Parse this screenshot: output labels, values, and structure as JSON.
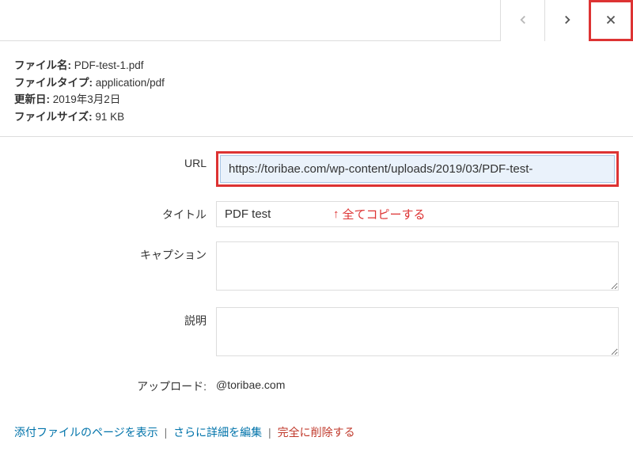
{
  "nav": {
    "prev_aria": "前へ",
    "next_aria": "次へ",
    "close_aria": "閉じる"
  },
  "meta": {
    "filename_label": "ファイル名:",
    "filename_value": "PDF-test-1.pdf",
    "filetype_label": "ファイルタイプ:",
    "filetype_value": "application/pdf",
    "updated_label": "更新日:",
    "updated_value": "2019年3月2日",
    "filesize_label": "ファイルサイズ:",
    "filesize_value": "91 KB"
  },
  "fields": {
    "url_label": "URL",
    "url_value": "https://toribae.com/wp-content/uploads/2019/03/PDF-test-",
    "title_label": "タイトル",
    "title_value": "PDF test",
    "caption_label": "キャプション",
    "caption_value": "",
    "desc_label": "説明",
    "desc_value": "",
    "uploader_label": "アップロード:",
    "uploader_value": "@toribae.com"
  },
  "annotation": {
    "arrow": "↑",
    "text": "全てコピーする"
  },
  "footer": {
    "view_page": "添付ファイルのページを表示",
    "edit_more": "さらに詳細を編集",
    "delete": "完全に削除する",
    "sep": "|"
  }
}
